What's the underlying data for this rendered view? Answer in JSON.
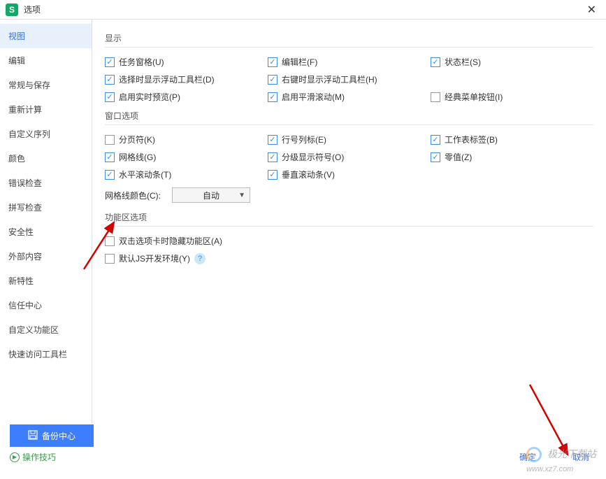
{
  "title": "选项",
  "sidebar": {
    "items": [
      "视图",
      "编辑",
      "常规与保存",
      "重新计算",
      "自定义序列",
      "颜色",
      "错误检查",
      "拼写检查",
      "安全性",
      "外部内容",
      "新特性",
      "信任中心",
      "自定义功能区",
      "快速访问工具栏"
    ],
    "active_index": 0
  },
  "sections": {
    "display": {
      "label": "显示",
      "rows": [
        [
          {
            "label": "任务窗格(U)",
            "checked": true
          },
          {
            "label": "编辑栏(F)",
            "checked": true
          },
          {
            "label": "状态栏(S)",
            "checked": true
          }
        ],
        [
          {
            "label": "选择时显示浮动工具栏(D)",
            "checked": true
          },
          {
            "label": "右键时显示浮动工具栏(H)",
            "checked": true
          },
          null
        ],
        [
          {
            "label": "启用实时预览(P)",
            "checked": true
          },
          {
            "label": "启用平滑滚动(M)",
            "checked": true
          },
          {
            "label": "经典菜单按钮(I)",
            "checked": false
          }
        ]
      ]
    },
    "window": {
      "label": "窗口选项",
      "rows": [
        [
          {
            "label": "分页符(K)",
            "checked": false
          },
          {
            "label": "行号列标(E)",
            "checked": true
          },
          {
            "label": "工作表标签(B)",
            "checked": true
          }
        ],
        [
          {
            "label": "网格线(G)",
            "checked": true
          },
          {
            "label": "分级显示符号(O)",
            "checked": true
          },
          {
            "label": "零值(Z)",
            "checked": true
          }
        ],
        [
          {
            "label": "水平滚动条(T)",
            "checked": true
          },
          {
            "label": "垂直滚动条(V)",
            "checked": true
          },
          null
        ]
      ],
      "grid_color_label": "网格线颜色(C):",
      "grid_color_value": "自动"
    },
    "ribbon": {
      "label": "功能区选项",
      "items": [
        {
          "label": "双击选项卡时隐藏功能区(A)",
          "checked": false,
          "help": false
        },
        {
          "label": "默认JS开发环境(Y)",
          "checked": false,
          "help": true
        }
      ]
    }
  },
  "footer": {
    "backup": "备份中心",
    "tips": "操作技巧",
    "ok": "确定",
    "cancel": "取消"
  },
  "watermark": {
    "brand": "极光下载站",
    "url": "www.xz7.com"
  }
}
